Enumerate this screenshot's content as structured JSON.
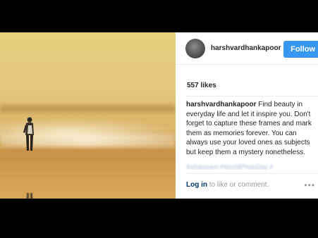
{
  "post": {
    "username": "harshvardhankapoor",
    "follow_label": "Follow",
    "likes": "557 likes",
    "caption_user": "harshvardhankapoor",
    "caption_text": " Find beauty in everyday life and let it inspire you. Don't forget to capture these frames and mark them as memories forever. You can always use your loved ones as subjects but keep them a mystery nonetheless.",
    "hashtags": "#whatsnext  #WorldPhotoDay  #",
    "login_link": "Log in",
    "login_text": " to like or comment.",
    "more_label": "•••"
  },
  "icons": {
    "avatar": "profile-avatar",
    "more": "more-options-icon"
  }
}
